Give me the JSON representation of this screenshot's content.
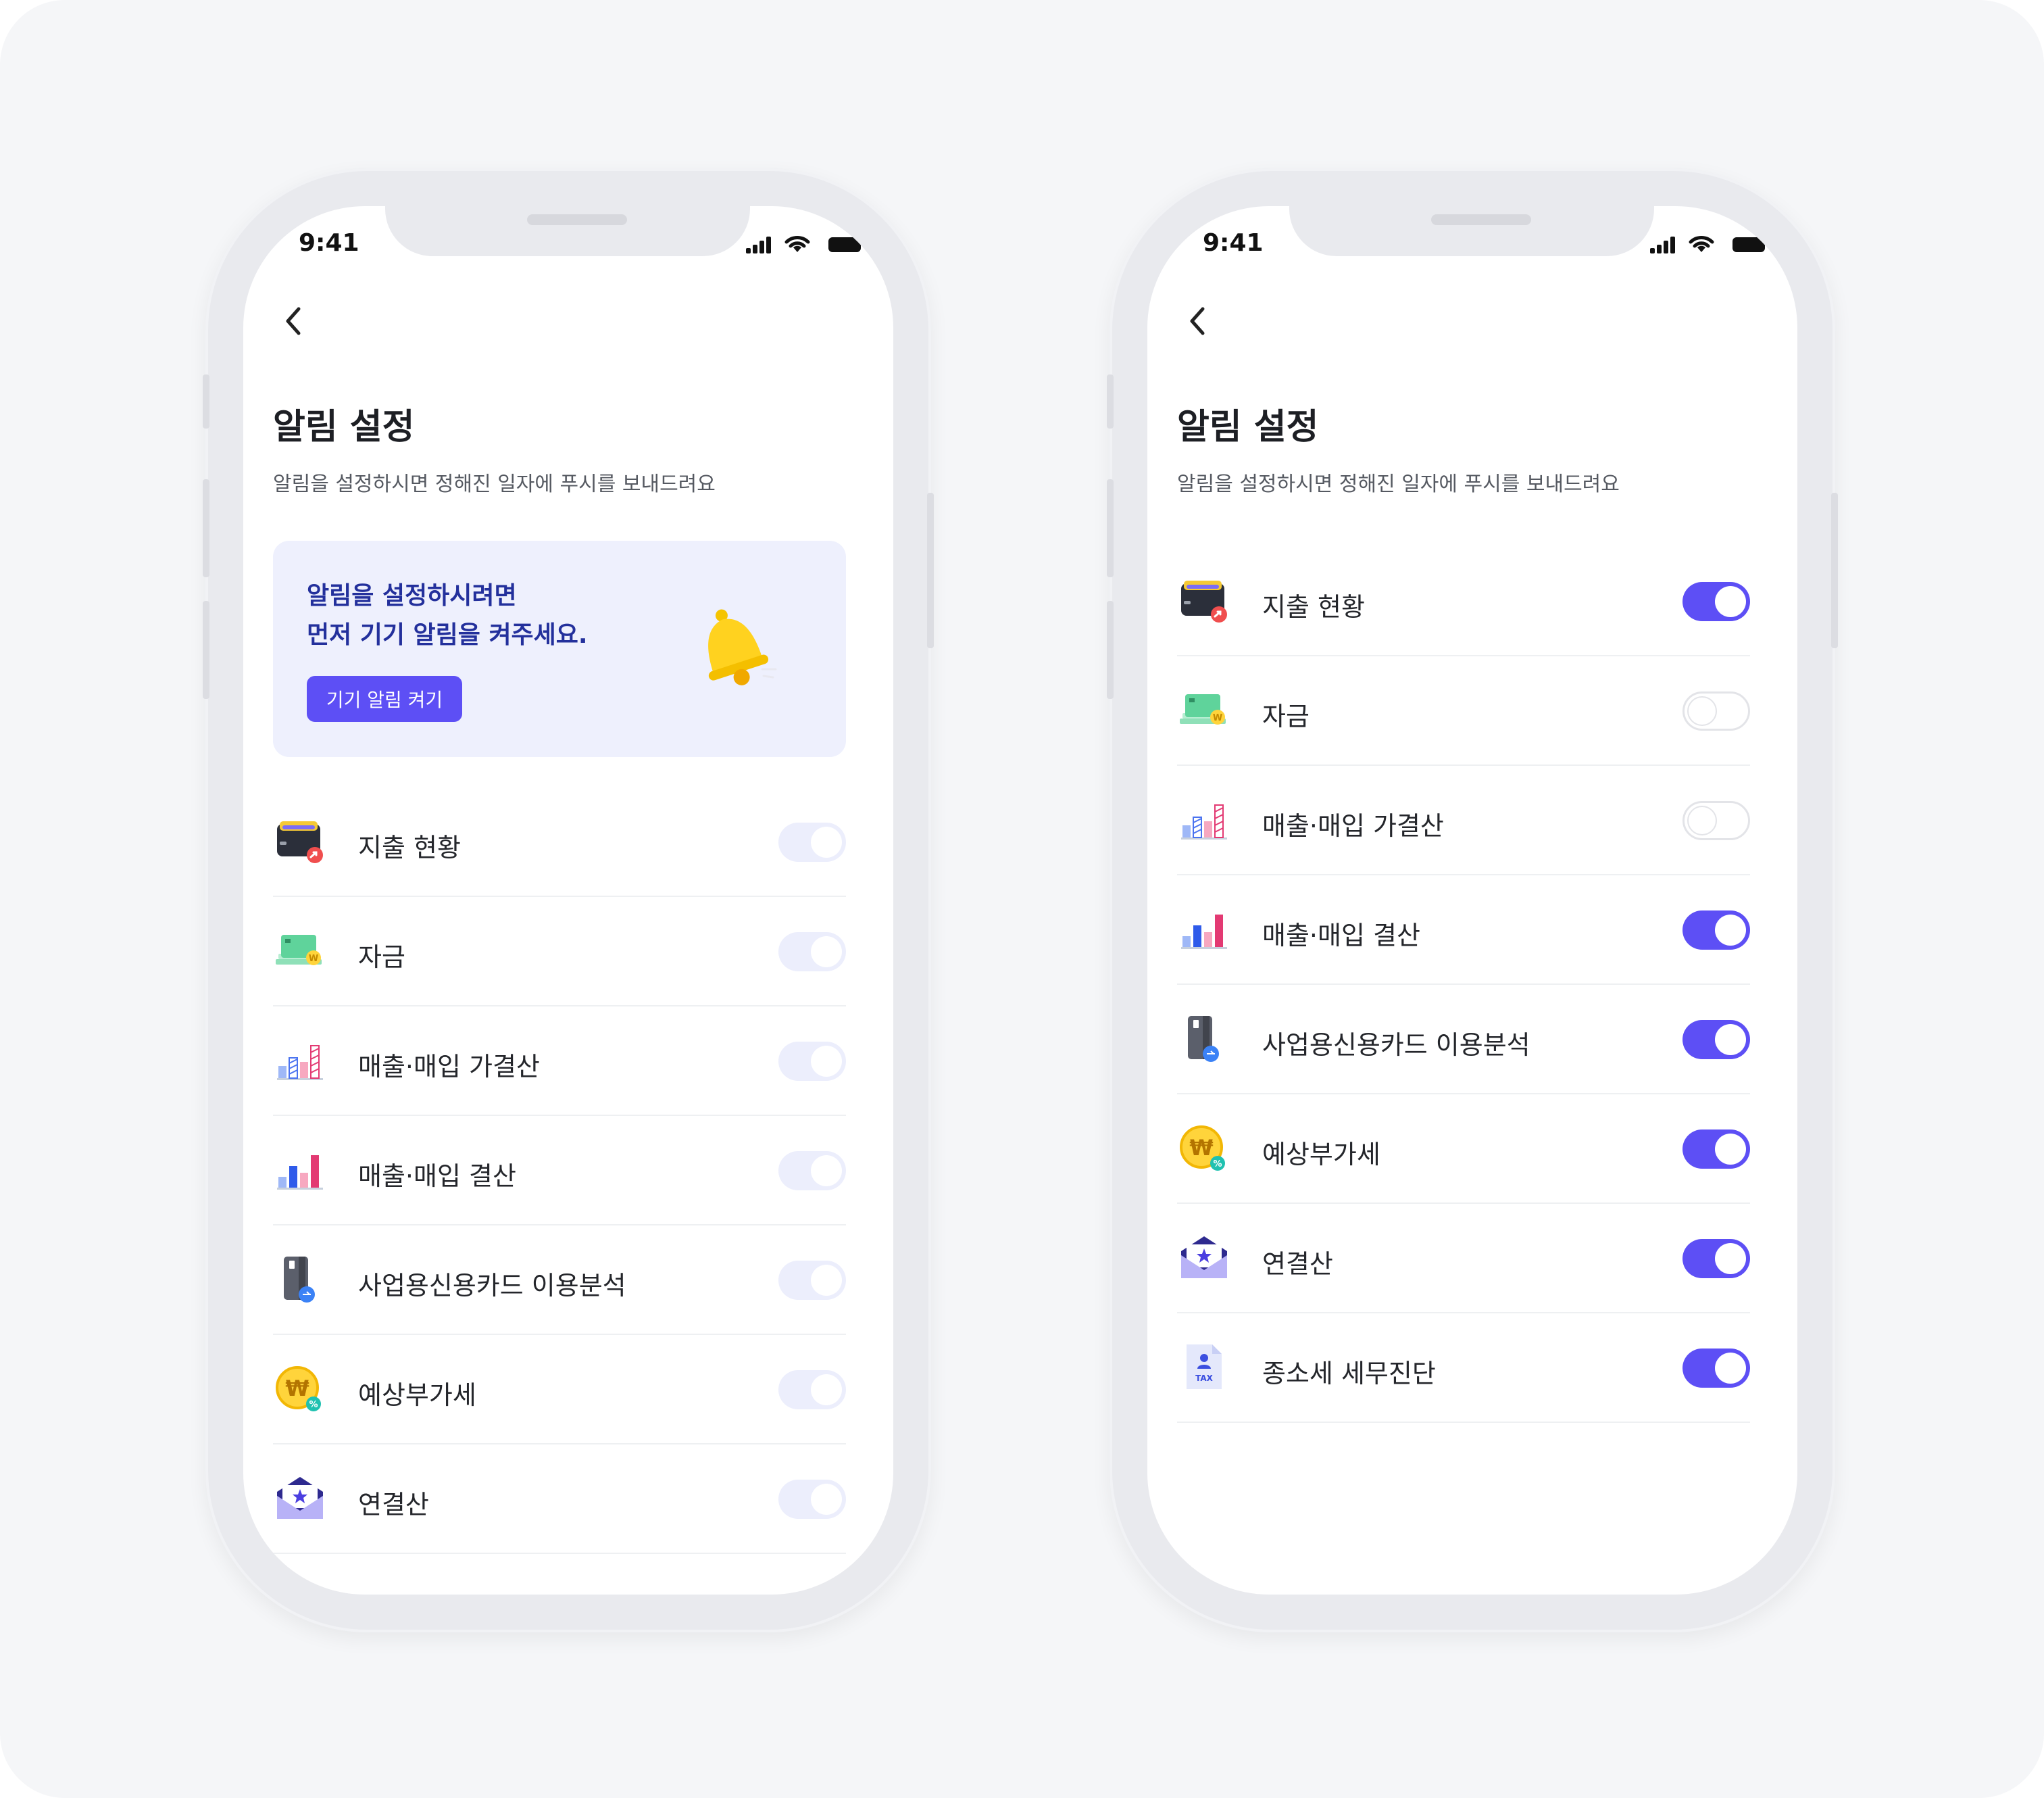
{
  "status": {
    "time": "9:41"
  },
  "page": {
    "title": "알림 설정",
    "subtitle": "알림을 설정하시면 정해진 일자에 푸시를 보내드려요"
  },
  "banner": {
    "line1": "알림을 설정하시려면",
    "line2": "먼저 기기 알림을 켜주세요.",
    "button_label": "기기 알림 켜기"
  },
  "left_screen": {
    "items": [
      {
        "label": "지출 현황",
        "icon": "wallet-icon",
        "toggle": "disabled"
      },
      {
        "label": "자금",
        "icon": "cash-icon",
        "toggle": "disabled"
      },
      {
        "label": "매출·매입 가결산",
        "icon": "striped-chart-icon",
        "toggle": "disabled"
      },
      {
        "label": "매출·매입 결산",
        "icon": "bar-chart-icon",
        "toggle": "disabled"
      },
      {
        "label": "사업용신용카드 이용분석",
        "icon": "credit-card-icon",
        "toggle": "disabled"
      },
      {
        "label": "예상부가세",
        "icon": "won-coin-icon",
        "toggle": "disabled"
      },
      {
        "label": "연결산",
        "icon": "envelope-star-icon",
        "toggle": "disabled"
      }
    ]
  },
  "right_screen": {
    "items": [
      {
        "label": "지출 현황",
        "icon": "wallet-icon",
        "toggle": "on"
      },
      {
        "label": "자금",
        "icon": "cash-icon",
        "toggle": "off"
      },
      {
        "label": "매출·매입 가결산",
        "icon": "striped-chart-icon",
        "toggle": "off"
      },
      {
        "label": "매출·매입 결산",
        "icon": "bar-chart-icon",
        "toggle": "on"
      },
      {
        "label": "사업용신용카드 이용분석",
        "icon": "credit-card-icon",
        "toggle": "on"
      },
      {
        "label": "예상부가세",
        "icon": "won-coin-icon",
        "toggle": "on"
      },
      {
        "label": "연결산",
        "icon": "envelope-star-icon",
        "toggle": "on"
      },
      {
        "label": "종소세 세무진단",
        "icon": "tax-document-icon",
        "toggle": "on"
      }
    ]
  },
  "colors": {
    "accent": "#5d4ff5",
    "banner_bg": "#eef0fd",
    "banner_text": "#23309c",
    "toggle_disabled": "#eceefc"
  }
}
